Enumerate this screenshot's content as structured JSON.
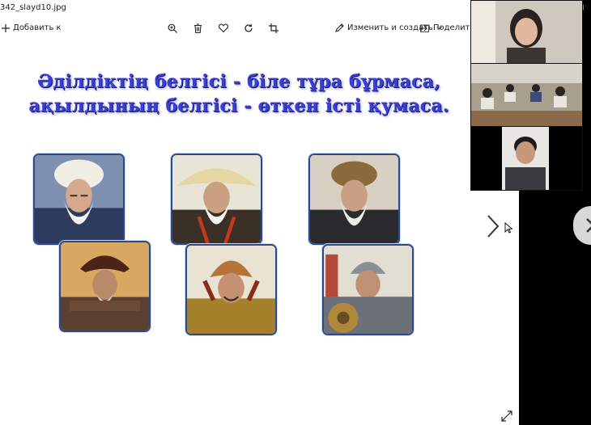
{
  "titlebar": {
    "filename": "342_slayd10.jpg"
  },
  "toolbar": {
    "add_label": "Добавить к",
    "edit_create_label": "Изменить и создать",
    "share_label": "Поделиться"
  },
  "slide": {
    "heading_line1": "Әділдіктің белгісі - біле тұра бұрмаса,",
    "heading_line2": "ақылдының белгісі - өткен істі қумаса."
  },
  "colors": {
    "heading": "#3b3fd8",
    "frame": "#2a4a8a"
  }
}
